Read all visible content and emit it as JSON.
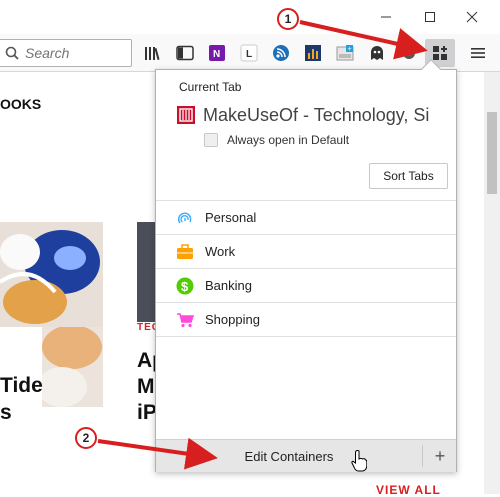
{
  "toolbar": {
    "search_placeholder": "Search"
  },
  "page": {
    "heading_fragment": "OOKS",
    "article_category": "TEC",
    "article_title_lines": [
      "Ap",
      "M",
      "iP"
    ],
    "left_title_lines": [
      "Tide",
      "s"
    ],
    "view_all": "VIEW ALL"
  },
  "panel": {
    "current_tab_label": "Current Tab",
    "current_tab_title": "MakeUseOf - Technology, Si",
    "always_open_label": "Always open in Default",
    "sort_tabs_label": "Sort Tabs",
    "containers": [
      {
        "label": "Personal",
        "icon": "fingerprint-icon",
        "color": "#37adff"
      },
      {
        "label": "Work",
        "icon": "briefcase-icon",
        "color": "#ff9f00"
      },
      {
        "label": "Banking",
        "icon": "dollar-icon",
        "color": "#51cd00"
      },
      {
        "label": "Shopping",
        "icon": "cart-icon",
        "color": "#ff4bda"
      }
    ],
    "edit_containers_label": "Edit Containers",
    "add_label": "+"
  },
  "annotations": {
    "step1": "1",
    "step2": "2"
  },
  "colors": {
    "accent_red": "#d71f1f",
    "mu_red": "#c8102e"
  }
}
